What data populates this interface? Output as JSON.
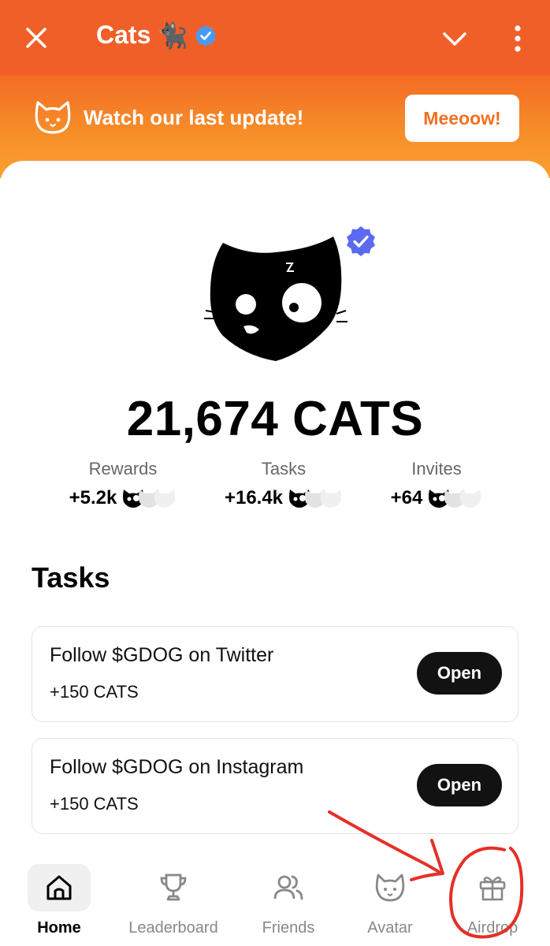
{
  "topbar": {
    "title": "Cats",
    "title_emoji": "🐈‍⬛",
    "icons": [
      "close-icon",
      "verified-badge-icon",
      "chevron-down-icon",
      "more-vertical-icon"
    ]
  },
  "banner": {
    "text": "Watch our last update!",
    "button_label": "Meeoow!"
  },
  "balance": "21,674 CATS",
  "stats": [
    {
      "label": "Rewards",
      "value": "+5.2k"
    },
    {
      "label": "Tasks",
      "value": "+16.4k"
    },
    {
      "label": "Invites",
      "value": "+64"
    }
  ],
  "tasks_section": {
    "title": "Tasks",
    "items": [
      {
        "title": "Follow $GDOG on Twitter",
        "reward": "+150 CATS",
        "button": "Open"
      },
      {
        "title": "Follow $GDOG on Instagram",
        "reward": "+150 CATS",
        "button": "Open"
      }
    ]
  },
  "nav": {
    "items": [
      {
        "label": "Home",
        "icon": "home-icon",
        "active": true
      },
      {
        "label": "Leaderboard",
        "icon": "trophy-icon",
        "active": false
      },
      {
        "label": "Friends",
        "icon": "friends-icon",
        "active": false
      },
      {
        "label": "Avatar",
        "icon": "cat-face-icon",
        "active": false
      },
      {
        "label": "Airdrop",
        "icon": "gift-icon",
        "active": false
      }
    ]
  },
  "colors": {
    "brand_orange": "#f15f28",
    "banner_orange": "#f7902a",
    "verified_blue": "#5b6af0",
    "annotation_red": "#e53027"
  }
}
